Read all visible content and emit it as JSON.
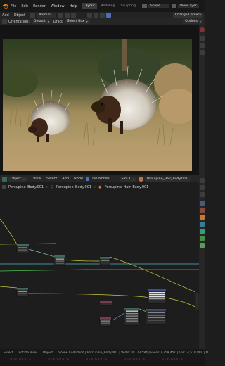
{
  "topbar": {
    "menu": [
      "File",
      "Edit",
      "Render",
      "Window",
      "Help"
    ],
    "workspaces": [
      "Layout",
      "Modeling",
      "Sculpting"
    ],
    "scene": "Scene",
    "view_layer": "ViewLayer"
  },
  "viewport_header": {
    "add": "Add",
    "object": "Object",
    "mode": "Normal",
    "change_camera": "Change Camera"
  },
  "viewport_header2": {
    "orientation_label": "Orientation:",
    "orientation_value": "Default",
    "drag_label": "Drag:",
    "drag_value": "Select Box",
    "options": "Options"
  },
  "render_image": {
    "subject": "two porcupines in dry grass",
    "colors": {
      "sky": "#2c3d1e",
      "ground": "#b49a6e",
      "grass": "#8a7a4a",
      "animal": "#3a2418",
      "quills": "#e8e4dc"
    }
  },
  "node_header": {
    "object": "Object",
    "view": "View",
    "select": "Select",
    "add": "Add",
    "node": "Node",
    "use_nodes": "Use Nodes",
    "slot": "Slot 1",
    "material": "Porcupine_Hair_Body.001"
  },
  "breadcrumb": [
    "Porcupine_Body.001",
    "Porcupine_Body.001",
    "Porcupine_Hair_Body.001"
  ],
  "status_bar": {
    "select": "Select",
    "rotate_view": "Rotate View",
    "object": "Object",
    "stats": "Scene Collection | Porcupine_Body.001 | Verts:10,173,584 | Faces:7,259,451 | Tris:14,518,884 | O"
  },
  "watermark": "VFX GRACE",
  "accent_color": "#4772b3",
  "node_wire_color": "#c8c83c"
}
